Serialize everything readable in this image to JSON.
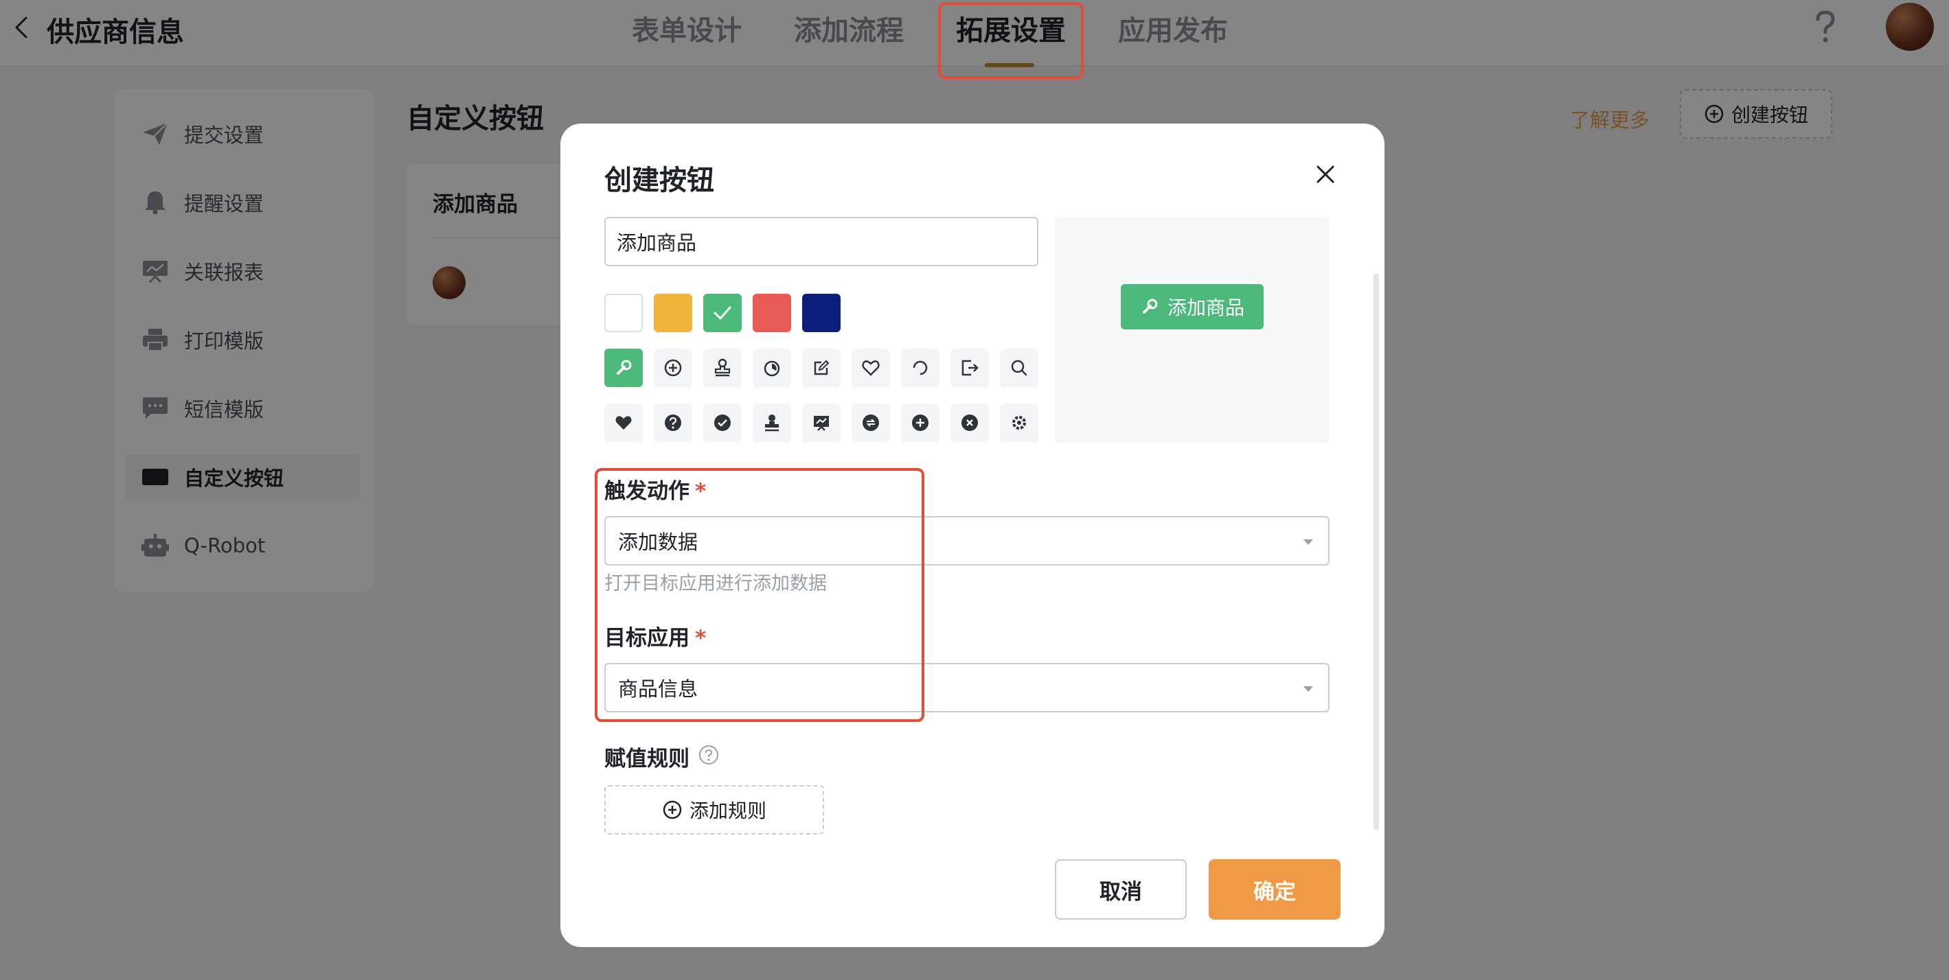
{
  "header": {
    "back_icon": "chevron-left-icon",
    "title": "供应商信息",
    "tabs": [
      {
        "label": "表单设计",
        "active": false
      },
      {
        "label": "添加流程",
        "active": false
      },
      {
        "label": "拓展设置",
        "active": true
      },
      {
        "label": "应用发布",
        "active": false
      }
    ],
    "help_icon": "question-mark-icon",
    "accent": "#c08a3e"
  },
  "sidebar": {
    "items": [
      {
        "label": "提交设置",
        "icon": "paper-plane-icon",
        "active": false
      },
      {
        "label": "提醒设置",
        "icon": "bell-icon",
        "active": false
      },
      {
        "label": "关联报表",
        "icon": "report-icon",
        "active": false
      },
      {
        "label": "打印模版",
        "icon": "printer-icon",
        "active": false
      },
      {
        "label": "短信模版",
        "icon": "message-icon",
        "active": false
      },
      {
        "label": "自定义按钮",
        "icon": "keyboard-icon",
        "active": true
      },
      {
        "label": "Q-Robot",
        "icon": "robot-icon",
        "active": false
      }
    ]
  },
  "content": {
    "title": "自定义按钮",
    "learn_more": "了解更多",
    "create_button": "创建按钮",
    "card": {
      "title": "添加商品"
    }
  },
  "modal": {
    "title": "创建按钮",
    "name_value": "添加商品",
    "colors": [
      {
        "hex": "#ffffff",
        "selected": false
      },
      {
        "hex": "#f0b43c",
        "selected": false
      },
      {
        "hex": "#4cb97a",
        "selected": true
      },
      {
        "hex": "#ea5b55",
        "selected": false
      },
      {
        "hex": "#0d1f7a",
        "selected": false
      }
    ],
    "icons_row1": [
      "wrench-icon",
      "plus-circle-icon",
      "stamp-icon",
      "timer-icon",
      "edit-box-icon",
      "heart-outline-icon",
      "refresh-icon",
      "export-icon",
      "search-icon"
    ],
    "icons_row2": [
      "heart-icon",
      "question-circle-icon",
      "check-circle-icon",
      "user-stamp-icon",
      "shop-icon",
      "sync-circle-icon",
      "plus-circle-solid-icon",
      "close-circle-icon",
      "gear-icon"
    ],
    "selected_icon": "wrench-icon",
    "preview_label": "添加商品",
    "trigger": {
      "label": "触发动作",
      "required": "*",
      "value": "添加数据",
      "hint": "打开目标应用进行添加数据"
    },
    "target": {
      "label": "目标应用",
      "required": "*",
      "value": "商品信息"
    },
    "rules": {
      "label": "赋值规则",
      "add_label": "添加规则"
    },
    "cancel_label": "取消",
    "confirm_label": "确定"
  },
  "colors": {
    "primary_green": "#4cb97a",
    "confirm_orange": "#f09a48",
    "annotation_red": "#e34d3a"
  }
}
